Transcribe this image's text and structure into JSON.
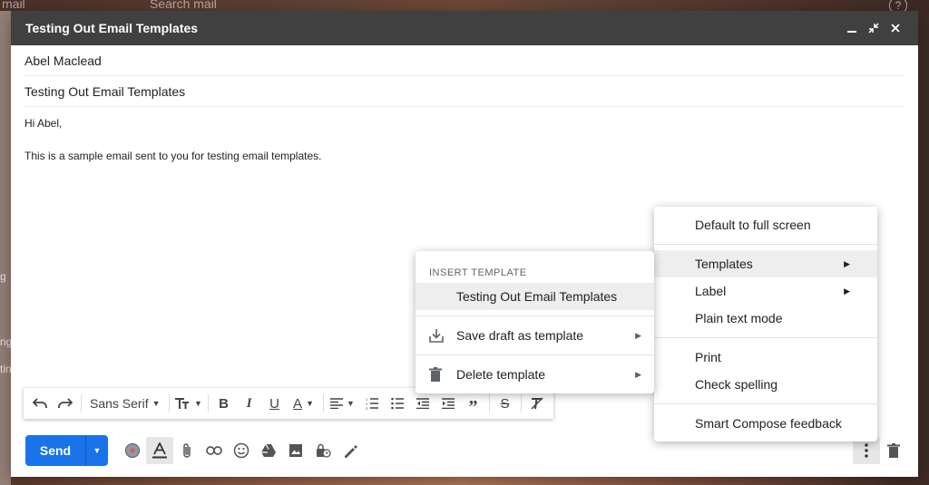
{
  "background": {
    "app_label": "mail",
    "search_placeholder": "Search mail",
    "help_glyph": "?",
    "side_letters": [
      "g",
      "ng",
      "tin"
    ]
  },
  "compose": {
    "title": "Testing Out Email Templates",
    "to": "Abel Maclead",
    "subject": "Testing Out Email Templates",
    "body_greeting": "Hi Abel,",
    "body_text": "This is a sample email sent to you for testing email templates."
  },
  "toolbar": {
    "font_name": "Sans Serif"
  },
  "send": {
    "label": "Send",
    "accent_color": "#1a73e8"
  },
  "more_menu": {
    "items": [
      {
        "label": "Default to full screen"
      },
      {
        "label": "Templates",
        "has_submenu": true,
        "highlighted": true
      },
      {
        "label": "Label",
        "has_submenu": true
      },
      {
        "label": "Plain text mode"
      },
      {
        "label": "Print"
      },
      {
        "label": "Check spelling"
      },
      {
        "label": "Smart Compose feedback"
      }
    ]
  },
  "templates_menu": {
    "header": "INSERT TEMPLATE",
    "insert_items": [
      {
        "label": "Testing Out Email Templates",
        "highlighted": true
      }
    ],
    "save_label": "Save draft as template",
    "delete_label": "Delete template",
    "save_icon": "save-download-icon",
    "delete_icon": "trash-icon"
  }
}
